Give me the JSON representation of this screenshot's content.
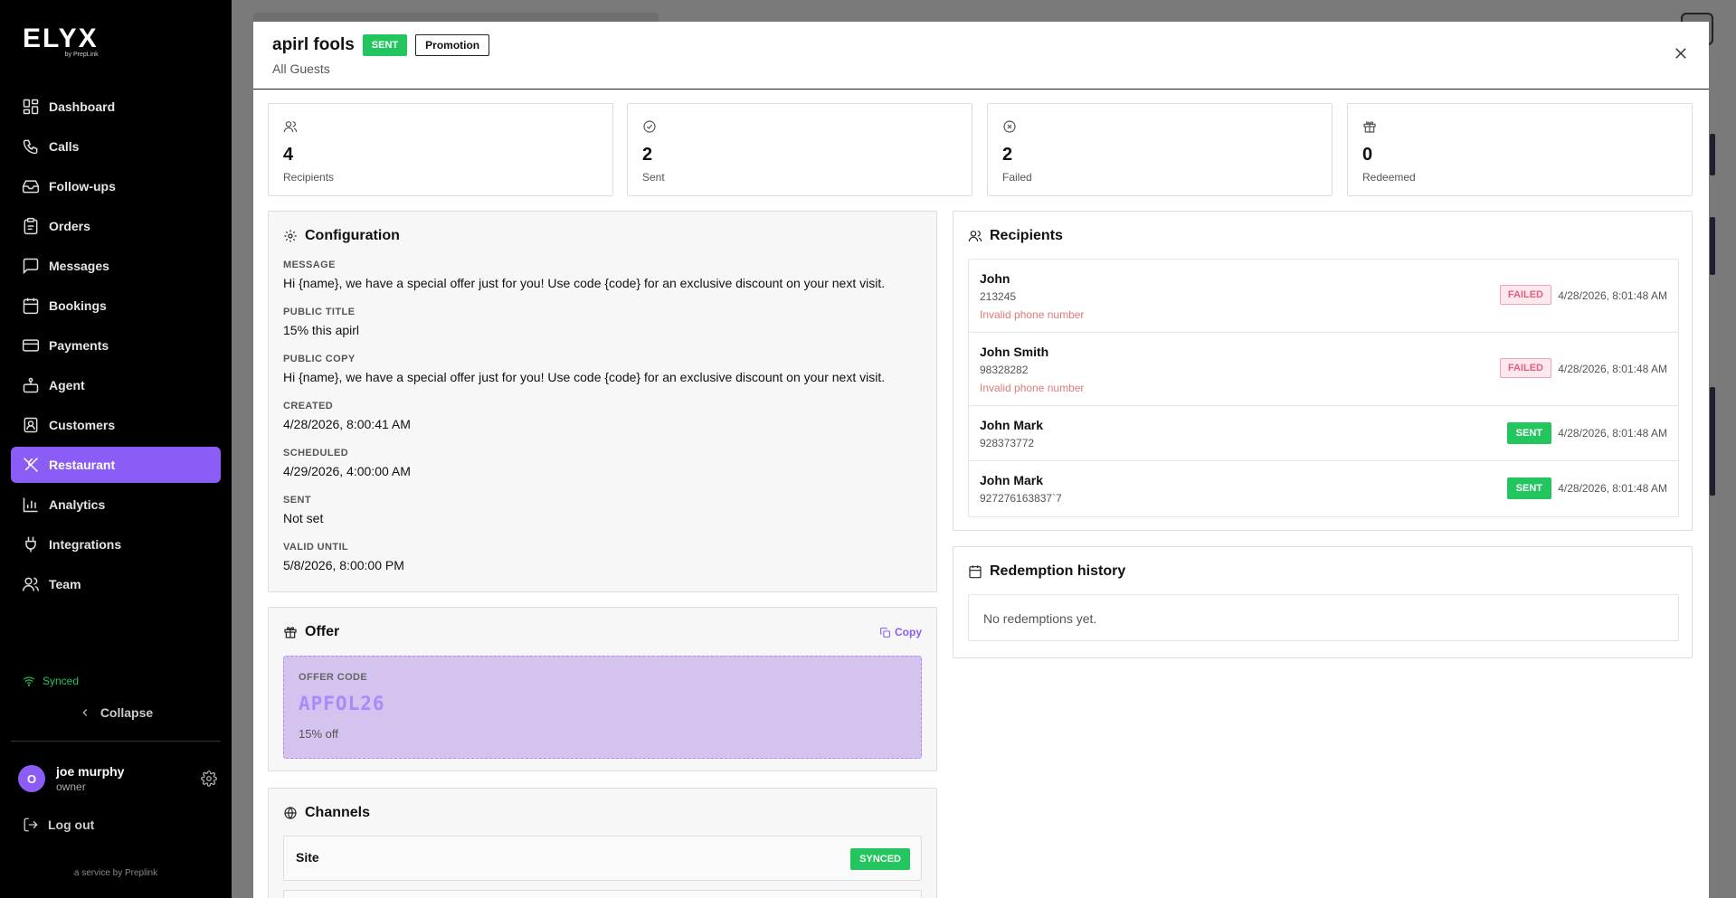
{
  "brand": {
    "name": "ELYX",
    "sub": "by PrepLink"
  },
  "sidebar": {
    "items": [
      {
        "label": "Dashboard",
        "icon": "dashboard-icon"
      },
      {
        "label": "Calls",
        "icon": "phone-icon"
      },
      {
        "label": "Follow-ups",
        "icon": "inbox-icon"
      },
      {
        "label": "Orders",
        "icon": "clipboard-icon"
      },
      {
        "label": "Messages",
        "icon": "message-icon"
      },
      {
        "label": "Bookings",
        "icon": "calendar-icon"
      },
      {
        "label": "Payments",
        "icon": "credit-card-icon"
      },
      {
        "label": "Agent",
        "icon": "bot-icon"
      },
      {
        "label": "Customers",
        "icon": "contact-icon"
      },
      {
        "label": "Restaurant",
        "icon": "utensils-icon",
        "active": true
      },
      {
        "label": "Analytics",
        "icon": "chart-icon"
      },
      {
        "label": "Integrations",
        "icon": "plug-icon"
      },
      {
        "label": "Team",
        "icon": "users-icon"
      }
    ],
    "synced_label": "Synced",
    "collapse_label": "Collapse",
    "user": {
      "initial": "O",
      "name": "joe murphy",
      "role": "owner"
    },
    "logout_label": "Log out",
    "footer": "a service by Preplink"
  },
  "modal": {
    "title": "apirl fools",
    "status_badge": "SENT",
    "type_badge": "Promotion",
    "audience": "All Guests",
    "stats": [
      {
        "value": "4",
        "label": "Recipients",
        "icon": "users-icon"
      },
      {
        "value": "2",
        "label": "Sent",
        "icon": "check-circle-icon"
      },
      {
        "value": "2",
        "label": "Failed",
        "icon": "x-circle-icon"
      },
      {
        "value": "0",
        "label": "Redeemed",
        "icon": "gift-icon"
      }
    ],
    "configuration": {
      "title": "Configuration",
      "fields": [
        {
          "label": "MESSAGE",
          "value": "Hi {name}, we have a special offer just for you! Use code {code} for an exclusive discount on your next visit."
        },
        {
          "label": "PUBLIC TITLE",
          "value": "15% this apirl"
        },
        {
          "label": "PUBLIC COPY",
          "value": "Hi {name}, we have a special offer just for you! Use code {code} for an exclusive discount on your next visit."
        },
        {
          "label": "CREATED",
          "value": "4/28/2026, 8:00:41 AM"
        },
        {
          "label": "SCHEDULED",
          "value": "4/29/2026, 4:00:00 AM"
        },
        {
          "label": "SENT",
          "value": "Not set"
        },
        {
          "label": "VALID UNTIL",
          "value": "5/8/2026, 8:00:00 PM"
        }
      ]
    },
    "offer": {
      "title": "Offer",
      "copy_label": "Copy",
      "code_label": "OFFER CODE",
      "code": "APFOL26",
      "description": "15% off"
    },
    "channels": {
      "title": "Channels",
      "items": [
        {
          "name": "Site",
          "status": "SYNCED"
        }
      ]
    },
    "recipients": {
      "title": "Recipients",
      "items": [
        {
          "name": "John",
          "phone": "213245",
          "status": "FAILED",
          "error": "Invalid phone number",
          "time": "4/28/2026, 8:01:48 AM"
        },
        {
          "name": "John Smith",
          "phone": "98328282",
          "status": "FAILED",
          "error": "Invalid phone number",
          "time": "4/28/2026, 8:01:48 AM"
        },
        {
          "name": "John Mark",
          "phone": "928373772",
          "status": "SENT",
          "error": "",
          "time": "4/28/2026, 8:01:48 AM"
        },
        {
          "name": "John Mark",
          "phone": "927276163837`7",
          "status": "SENT",
          "error": "",
          "time": "4/28/2026, 8:01:48 AM"
        }
      ]
    },
    "redemption": {
      "title": "Redemption history",
      "empty": "No redemptions yet."
    }
  },
  "colors": {
    "accent": "#8b5cf6",
    "success": "#22c55e",
    "danger": "#e0607e",
    "sidebar_bg": "#000000"
  }
}
